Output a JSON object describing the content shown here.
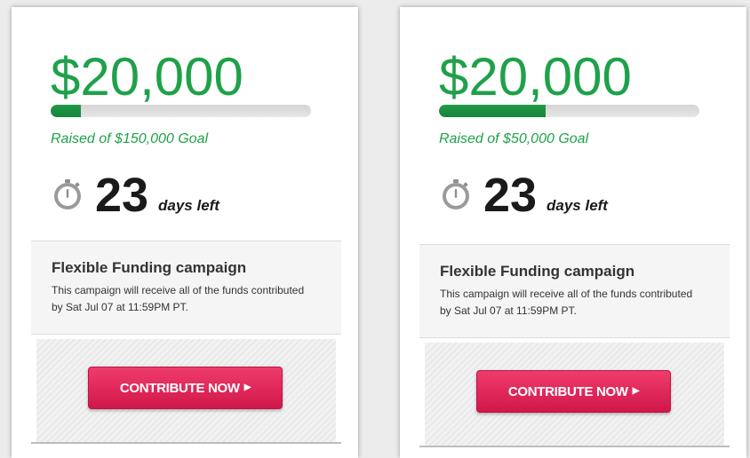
{
  "campaigns": [
    {
      "raised_amount": "$20,000",
      "progress_fraction": 0.115,
      "goal_text": "Raised of $150,000 Goal",
      "days_number": "23",
      "days_label": "days left",
      "funding_title": "Flexible Funding campaign",
      "funding_description": "This campaign will receive all of the funds contributed by Sat Jul 07 at 11:59PM PT.",
      "button_label": "CONTRIBUTE NOW",
      "button_icon": "play-triangle-icon"
    },
    {
      "raised_amount": "$20,000",
      "progress_fraction": 0.41,
      "goal_text": "Raised of $50,000 Goal",
      "days_number": "23",
      "days_label": "days left",
      "funding_title": "Flexible Funding campaign",
      "funding_description": "This campaign will receive all of the funds contributed by Sat Jul 07 at 11:59PM PT.",
      "button_label": "CONTRIBUTE NOW",
      "button_icon": "play-triangle-icon"
    }
  ],
  "colors": {
    "raised_green": "#1fa14a",
    "progress_fill": "#1b8f41",
    "progress_track": "#dcdcdc",
    "button_red": "#e02a5b",
    "text_dark": "#1a1a1a"
  },
  "icons": {
    "timer": "stopwatch-icon"
  }
}
